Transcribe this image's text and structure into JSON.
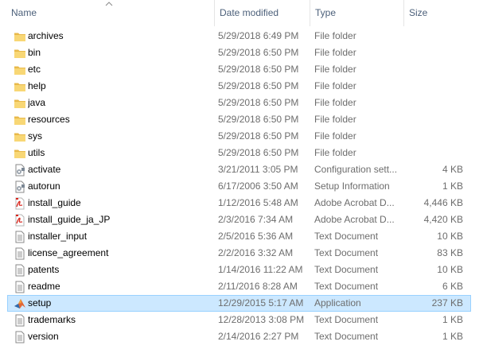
{
  "columns": {
    "name": "Name",
    "date": "Date modified",
    "type": "Type",
    "size": "Size"
  },
  "sort": {
    "column": "name",
    "direction": "ascending",
    "icon": "sort-up-icon"
  },
  "colors": {
    "header_text": "#4c607a",
    "detail_text": "#6d6d6d",
    "selection_bg": "#cce8ff",
    "selection_border": "#99d1ff",
    "folder": "#f8d775"
  },
  "files": [
    {
      "name": "archives",
      "date": "5/29/2018 6:49 PM",
      "type": "File folder",
      "size": "",
      "icon": "folder-icon",
      "selected": false
    },
    {
      "name": "bin",
      "date": "5/29/2018 6:50 PM",
      "type": "File folder",
      "size": "",
      "icon": "folder-icon",
      "selected": false
    },
    {
      "name": "etc",
      "date": "5/29/2018 6:50 PM",
      "type": "File folder",
      "size": "",
      "icon": "folder-icon",
      "selected": false
    },
    {
      "name": "help",
      "date": "5/29/2018 6:50 PM",
      "type": "File folder",
      "size": "",
      "icon": "folder-icon",
      "selected": false
    },
    {
      "name": "java",
      "date": "5/29/2018 6:50 PM",
      "type": "File folder",
      "size": "",
      "icon": "folder-icon",
      "selected": false
    },
    {
      "name": "resources",
      "date": "5/29/2018 6:50 PM",
      "type": "File folder",
      "size": "",
      "icon": "folder-icon",
      "selected": false
    },
    {
      "name": "sys",
      "date": "5/29/2018 6:50 PM",
      "type": "File folder",
      "size": "",
      "icon": "folder-icon",
      "selected": false
    },
    {
      "name": "utils",
      "date": "5/29/2018 6:50 PM",
      "type": "File folder",
      "size": "",
      "icon": "folder-icon",
      "selected": false
    },
    {
      "name": "activate",
      "date": "3/21/2011 3:05 PM",
      "type": "Configuration sett...",
      "size": "4 KB",
      "icon": "config-file-icon",
      "selected": false
    },
    {
      "name": "autorun",
      "date": "6/17/2006 3:50 AM",
      "type": "Setup Information",
      "size": "1 KB",
      "icon": "config-file-icon",
      "selected": false
    },
    {
      "name": "install_guide",
      "date": "1/12/2016 5:48 AM",
      "type": "Adobe Acrobat D...",
      "size": "4,446 KB",
      "icon": "pdf-icon",
      "selected": false
    },
    {
      "name": "install_guide_ja_JP",
      "date": "2/3/2016 7:34 AM",
      "type": "Adobe Acrobat D...",
      "size": "4,420 KB",
      "icon": "pdf-icon",
      "selected": false
    },
    {
      "name": "installer_input",
      "date": "2/5/2016 5:36 AM",
      "type": "Text Document",
      "size": "10 KB",
      "icon": "text-file-icon",
      "selected": false
    },
    {
      "name": "license_agreement",
      "date": "2/2/2016 3:32 AM",
      "type": "Text Document",
      "size": "83 KB",
      "icon": "text-file-icon",
      "selected": false
    },
    {
      "name": "patents",
      "date": "1/14/2016 11:22 AM",
      "type": "Text Document",
      "size": "10 KB",
      "icon": "text-file-icon",
      "selected": false
    },
    {
      "name": "readme",
      "date": "2/11/2016 8:28 AM",
      "type": "Text Document",
      "size": "6 KB",
      "icon": "text-file-icon",
      "selected": false
    },
    {
      "name": "setup",
      "date": "12/29/2015 5:17 AM",
      "type": "Application",
      "size": "237 KB",
      "icon": "matlab-app-icon",
      "selected": true
    },
    {
      "name": "trademarks",
      "date": "12/28/2013 3:08 PM",
      "type": "Text Document",
      "size": "1 KB",
      "icon": "text-file-icon",
      "selected": false
    },
    {
      "name": "version",
      "date": "2/14/2016 2:27 PM",
      "type": "Text Document",
      "size": "1 KB",
      "icon": "text-file-icon",
      "selected": false
    }
  ]
}
